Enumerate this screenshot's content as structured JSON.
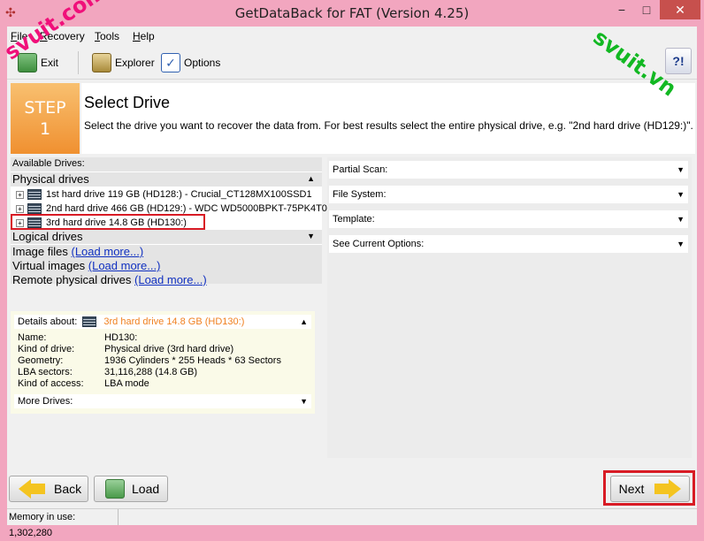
{
  "window": {
    "title": "GetDataBack for FAT (Version 4.25)",
    "minimize": "−",
    "maximize": "□",
    "close": "✕"
  },
  "menu": [
    {
      "label": "File",
      "ul": "F",
      "rest": "ile"
    },
    {
      "label": "Recovery",
      "ul": "R",
      "rest": "ecovery"
    },
    {
      "label": "Tools",
      "ul": "T",
      "rest": "ools"
    },
    {
      "label": "Help",
      "ul": "H",
      "rest": "elp"
    }
  ],
  "toolbar": {
    "exit": "Exit",
    "explorer": "Explorer",
    "options": "Options",
    "help_glyph": "?!"
  },
  "step": {
    "label": "STEP",
    "number": "1",
    "title": "Select Drive",
    "description": "Select the drive you want to recover the data from. For best results select the entire physical drive, e.g. \"2nd hard drive (HD129:)\"."
  },
  "left": {
    "available_label": "Available Drives:",
    "physical_label": "Physical drives",
    "drives": [
      "1st hard drive 119 GB (HD128:) - Crucial_CT128MX100SSD1",
      "2nd hard drive 466 GB (HD129:) - WDC WD5000BPKT-75PK4T0",
      "3rd hard drive 14.8 GB (HD130:)"
    ],
    "logical_label": "Logical drives",
    "image_files": "Image files",
    "virtual_images": "Virtual images",
    "remote_drives": "Remote physical drives",
    "load_more": "(Load more...)"
  },
  "right": {
    "partial_scan": "Partial Scan:",
    "file_system": "File System:",
    "template": "Template:",
    "current_options": "See Current Options:"
  },
  "details": {
    "header": "Details about:",
    "drive": "3rd hard drive 14.8 GB (HD130:)",
    "rows": [
      {
        "label": "Name:",
        "value": "HD130:"
      },
      {
        "label": "Kind of drive:",
        "value": "Physical drive (3rd hard drive)"
      },
      {
        "label": "Geometry:",
        "value": "1936 Cylinders * 255 Heads * 63 Sectors"
      },
      {
        "label": "LBA sectors:",
        "value": "31,116,288 (14.8 GB)"
      },
      {
        "label": "Kind of access:",
        "value": "LBA mode"
      }
    ],
    "more_drives": "More Drives:"
  },
  "footer": {
    "back": "Back",
    "load": "Load",
    "next": "Next"
  },
  "status": {
    "memory": "Memory in use: 1,302,280"
  },
  "watermarks": [
    "svuit.com",
    "svuit.vn"
  ],
  "glyphs": {
    "collapse": "▲",
    "expand": "▼",
    "plus": "+"
  },
  "colors": {
    "title_bar": "#f2a6bf",
    "step_orange": "#f09030",
    "highlight_red": "#d81b25",
    "link_blue": "#1030c0"
  }
}
